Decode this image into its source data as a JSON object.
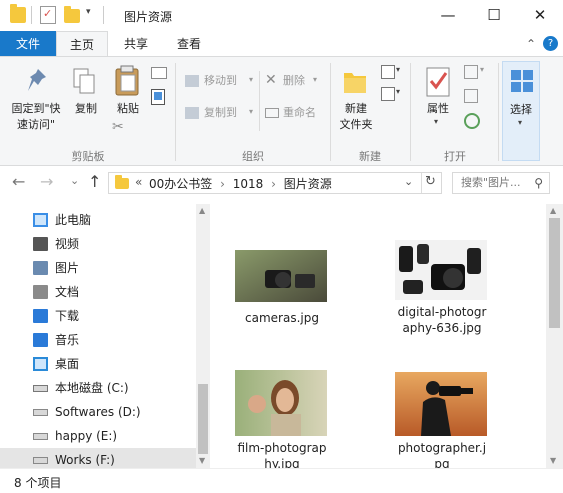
{
  "window": {
    "title": "图片资源",
    "min_glyph": "—",
    "max_glyph": "☐",
    "close_glyph": "✕"
  },
  "tabs": {
    "file": "文件",
    "home": "主页",
    "share": "共享",
    "view": "查看",
    "collapse_glyph": "⌃",
    "help_glyph": "?"
  },
  "ribbon": {
    "clipboard": {
      "pin_label_1": "固定到\"快",
      "pin_label_2": "速访问\"",
      "copy_label": "复制",
      "paste_label": "粘贴",
      "group_label": "剪贴板"
    },
    "organize": {
      "move_to": "移动到",
      "copy_to": "复制到",
      "delete": "删除",
      "rename": "重命名",
      "group_label": "组织"
    },
    "new": {
      "new_folder_1": "新建",
      "new_folder_2": "文件夹",
      "group_label": "新建"
    },
    "open": {
      "properties": "属性",
      "group_label": "打开"
    },
    "select": {
      "select_label": "选择"
    }
  },
  "address": {
    "breadcrumb_prefix": "«",
    "crumbs": [
      "00办公书签",
      "1018",
      "图片资源"
    ],
    "separator": "›",
    "search_placeholder": "搜索\"图片...",
    "back_glyph": "←",
    "forward_glyph": "→",
    "dropdown_glyph": "⌄",
    "up_glyph": "↑",
    "refresh_glyph": "↻",
    "search_glyph": "⚲"
  },
  "nav": {
    "items": [
      {
        "label": "此电脑",
        "icon": "computer-icon"
      },
      {
        "label": "视频",
        "icon": "video-folder-icon"
      },
      {
        "label": "图片",
        "icon": "pictures-folder-icon"
      },
      {
        "label": "文档",
        "icon": "documents-folder-icon"
      },
      {
        "label": "下载",
        "icon": "download-folder-icon"
      },
      {
        "label": "音乐",
        "icon": "music-folder-icon"
      },
      {
        "label": "桌面",
        "icon": "desktop-folder-icon"
      },
      {
        "label": "本地磁盘 (C:)",
        "icon": "drive-c-icon"
      },
      {
        "label": "Softwares (D:)",
        "icon": "drive-icon"
      },
      {
        "label": "happy (E:)",
        "icon": "drive-icon"
      },
      {
        "label": "Works (F:)",
        "icon": "drive-icon"
      }
    ]
  },
  "files": [
    {
      "name_1": "cameras.jpg",
      "name_2": ""
    },
    {
      "name_1": "digital-photogr",
      "name_2": "aphy-636.jpg"
    },
    {
      "name_1": "film-photograp",
      "name_2": "hy.jpg"
    },
    {
      "name_1": "photographer.j",
      "name_2": "pg"
    }
  ],
  "status": {
    "count": "8 个项目"
  },
  "colors": {
    "file_tab": "#1979ca",
    "ribbon_bg": "#f5f6f7",
    "selected_nav": "#cce8ff",
    "folder": "#f5c83d"
  }
}
